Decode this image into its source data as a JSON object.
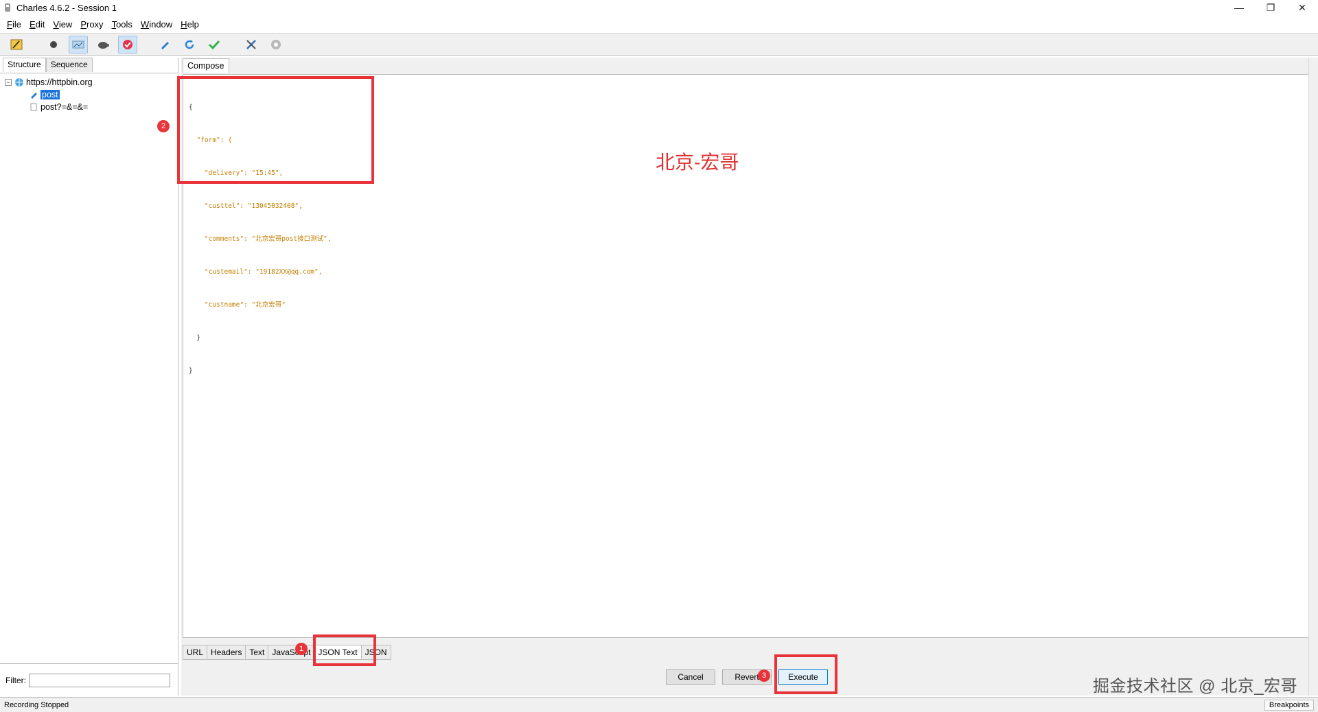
{
  "window": {
    "title": "Charles 4.6.2 - Session 1",
    "controls": {
      "minimize": "—",
      "restore": "❐",
      "close": "✕"
    }
  },
  "menu": [
    {
      "label": "File",
      "hot": "F",
      "rest": "ile"
    },
    {
      "label": "Edit",
      "hot": "E",
      "rest": "dit"
    },
    {
      "label": "View",
      "hot": "V",
      "rest": "iew"
    },
    {
      "label": "Proxy",
      "hot": "P",
      "rest": "roxy"
    },
    {
      "label": "Tools",
      "hot": "T",
      "rest": "ools"
    },
    {
      "label": "Window",
      "hot": "W",
      "rest": "indow"
    },
    {
      "label": "Help",
      "hot": "H",
      "rest": "elp"
    }
  ],
  "toolbar": {
    "icons": [
      "broom-icon",
      "record-icon",
      "throttle-icon",
      "turtle-icon",
      "breakpoint-icon",
      "compose-pen-icon",
      "refresh-icon",
      "validate-check-icon",
      "tools-icon",
      "settings-gear-icon"
    ],
    "active": [
      "throttle-icon",
      "breakpoint-icon"
    ]
  },
  "left": {
    "tabs": [
      "Structure",
      "Sequence"
    ],
    "tree": {
      "host": "https://httpbin.org",
      "items": [
        "post",
        "post?=&=&="
      ]
    },
    "filter_label": "Filter:",
    "filter_value": ""
  },
  "compose": {
    "tab": "Compose",
    "json_lines": [
      "{",
      "  \"form\": {",
      "    \"delivery\": \"15:45\",",
      "    \"custtel\": \"13045032408\",",
      "    \"comments\": \"北京宏哥post接口测试\",",
      "    \"custemail\": \"19182XX@qq.com\",",
      "    \"custname\": \"北京宏哥\"",
      "  }",
      "}"
    ],
    "overlay_text": "北京-宏哥",
    "bottom_tabs": [
      "URL",
      "Headers",
      "Text",
      "JavaScript",
      "JSON Text",
      "JSON"
    ],
    "selected_bottom_tab": "JSON Text",
    "buttons": {
      "cancel": "Cancel",
      "revert": "Revert",
      "execute": "Execute"
    }
  },
  "annotations": {
    "badge1": "1",
    "badge2": "2",
    "badge3": "3"
  },
  "watermark": "掘金技术社区 @ 北京_宏哥",
  "status": {
    "left": "Recording Stopped",
    "right": "Breakpoints"
  },
  "colors": {
    "annotation_red": "#e8333a",
    "selection_blue": "#1a73d9"
  }
}
